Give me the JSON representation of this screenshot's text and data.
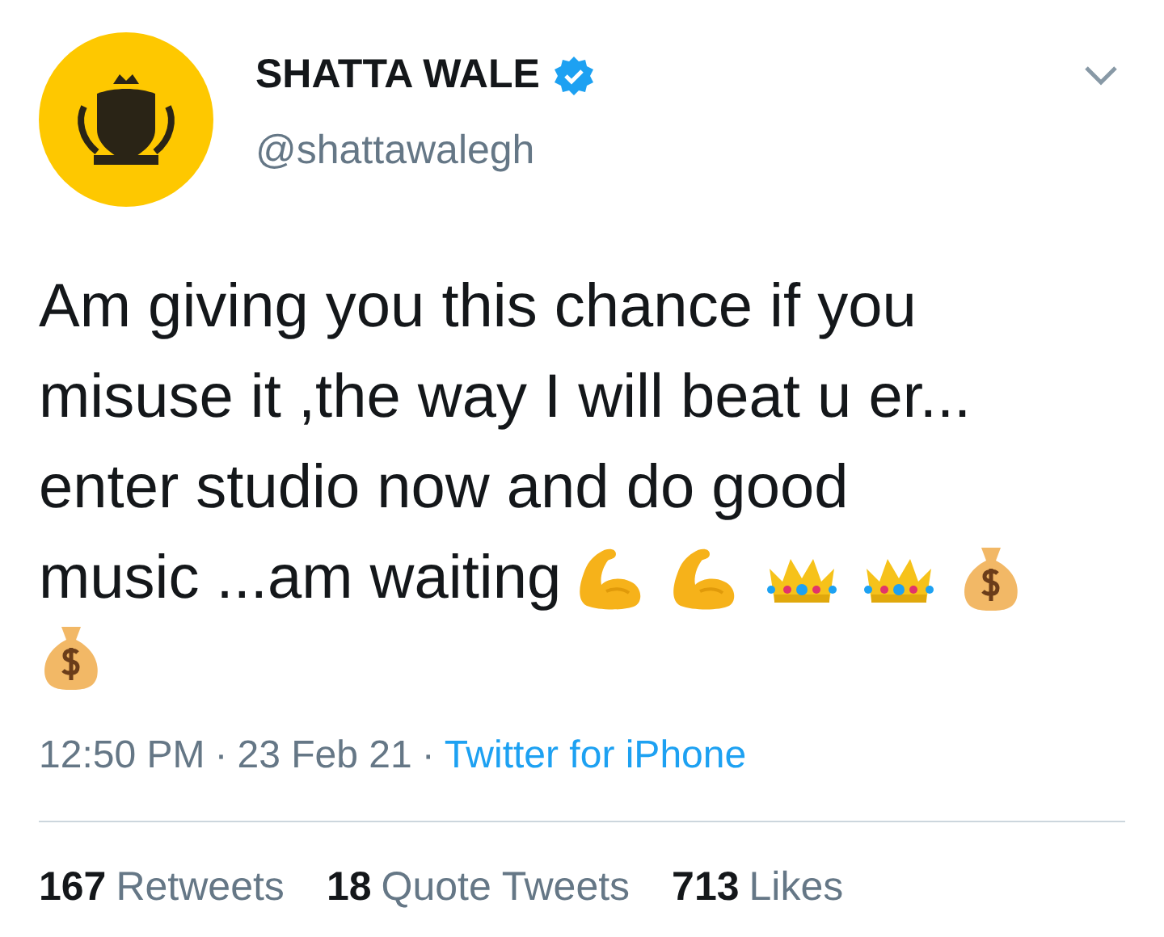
{
  "author": {
    "name": "SHATTA WALE",
    "verified": true,
    "handle": "@shattawalegh"
  },
  "tweet": {
    "lines": [
      "Am giving you this chance if you",
      "misuse it ,the way I will beat u er...",
      "enter studio now and do good",
      "music ...am waiting"
    ],
    "emojis": [
      {
        "kind": "muscle"
      },
      {
        "kind": "muscle"
      },
      {
        "kind": "crown"
      },
      {
        "kind": "crown"
      },
      {
        "kind": "moneybag"
      },
      {
        "kind": "moneybag"
      }
    ]
  },
  "meta": [
    {
      "kind": "time",
      "text": "12:50 PM"
    },
    {
      "kind": "separator",
      "text": "·"
    },
    {
      "kind": "date",
      "text": "23 Feb 21"
    },
    {
      "kind": "separator",
      "text": "·"
    },
    {
      "kind": "source",
      "text": "Twitter for iPhone"
    }
  ],
  "stats": [
    {
      "count": "167",
      "label": "Retweets"
    },
    {
      "count": "18",
      "label": "Quote Tweets"
    },
    {
      "count": "713",
      "label": "Likes"
    }
  ]
}
